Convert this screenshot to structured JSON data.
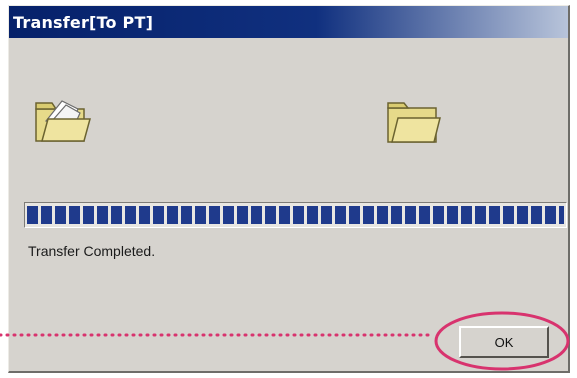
{
  "window": {
    "title": "Transfer[To PT]"
  },
  "transfer": {
    "status_text": "Transfer Completed.",
    "progress": 1.0
  },
  "buttons": {
    "ok_label": "OK"
  },
  "icons": {
    "source": "folder-open-icon",
    "destination": "folder-icon"
  },
  "colors": {
    "titlebar": "#06216a",
    "progress": "#1f3a8c",
    "highlight": "#d8336e",
    "dialog_bg": "#d6d3ce"
  }
}
